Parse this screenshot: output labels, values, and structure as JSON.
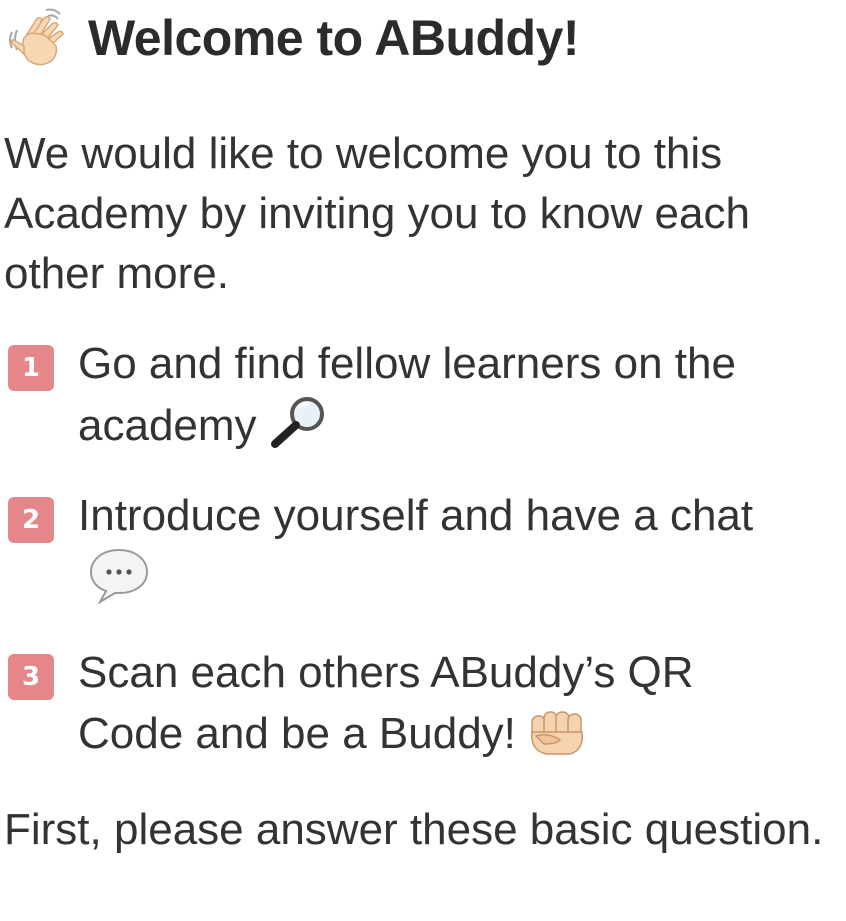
{
  "header": {
    "icon": "waving-hand-icon",
    "title": "Welcome to ABuddy!"
  },
  "intro": {
    "text": "We would like to welcome you to this Academy by inviting you to know each other more."
  },
  "steps": [
    {
      "number": "1",
      "text": "Go and find fellow learners on the academy",
      "icon": "magnifying-glass-icon"
    },
    {
      "number": "2",
      "text": "Introduce yourself and have a chat",
      "icon": "speech-bubble-icon"
    },
    {
      "number": "3",
      "text": "Scan each others ABuddy’s QR Code and be a Buddy!",
      "icon": "fist-bump-icon"
    }
  ],
  "closing": {
    "text": "First, please answer these basic question."
  },
  "colors": {
    "badge": "#e5868a",
    "text": "#333333"
  }
}
